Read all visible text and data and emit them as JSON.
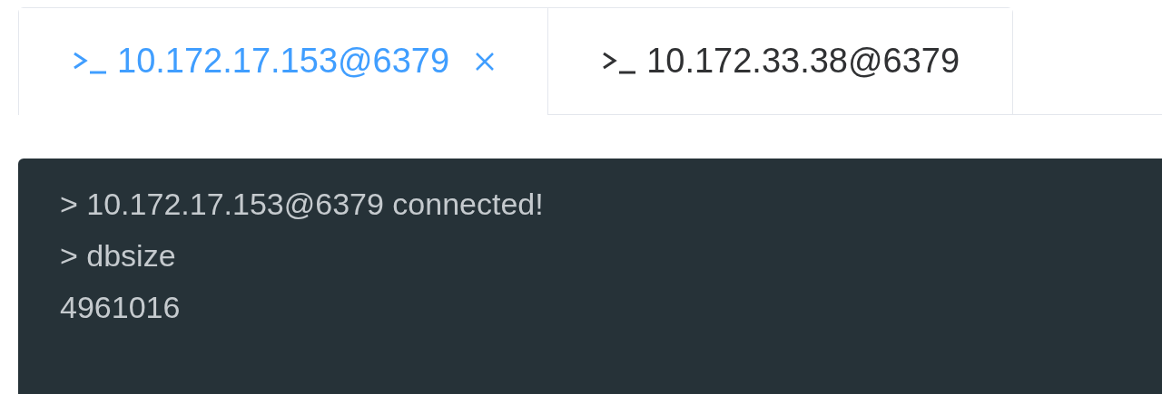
{
  "tabs": [
    {
      "label": "10.172.17.153@6379",
      "selected": true
    },
    {
      "label": "10.172.33.38@6379",
      "selected": false
    }
  ],
  "console": {
    "lines": [
      "> 10.172.17.153@6379 connected!",
      "> dbsize",
      "4961016"
    ]
  }
}
